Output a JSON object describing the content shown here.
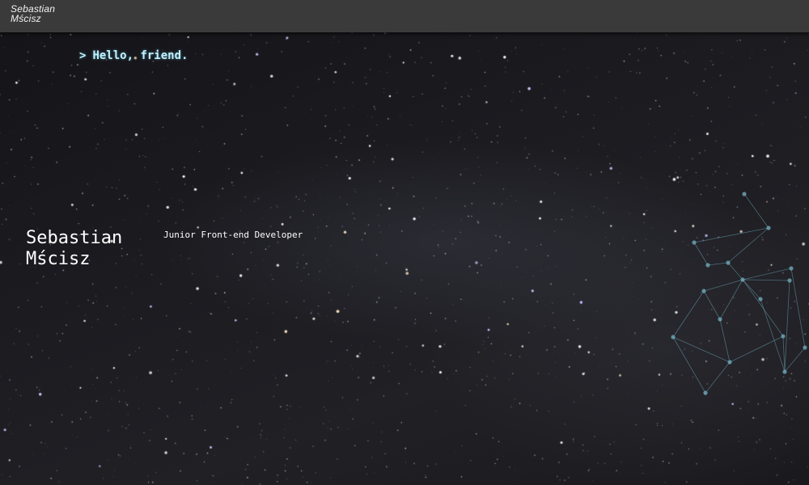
{
  "navbar": {
    "logo_text": "Sebastian\nMścisz"
  },
  "hero": {
    "greeting_prompt": ">",
    "greeting": "Hello, friend.",
    "name_line1": "Sebastian",
    "name_line2": "Mścisz",
    "role": "Junior Front-end Developer"
  },
  "colors": {
    "navbar_bg": "#3a3a3a",
    "greeting_text": "#bff2ff",
    "network_line": "#6fa8b8"
  },
  "background": {
    "icon": "starry-night-sky",
    "decoration": "network-constellation"
  }
}
